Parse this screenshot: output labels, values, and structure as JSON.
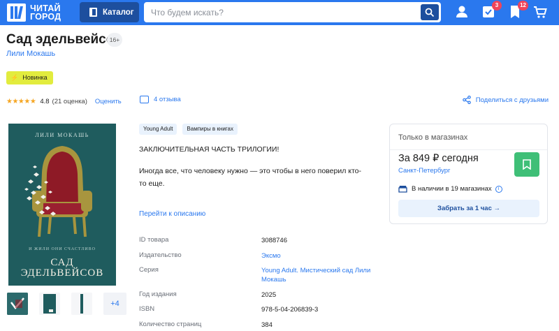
{
  "header": {
    "logo_line1": "ЧИТАЙ",
    "logo_line2": "ГОРОД",
    "catalog_label": "Каталог",
    "search_placeholder": "Что будем искать?",
    "cart_badge": "3",
    "bookmarks_badge": "12",
    "accent": "#2a78ee",
    "dark_accent": "#1d4f9e"
  },
  "product": {
    "title": "Сад эдельвейсов",
    "age_rating": "16+",
    "author": "Лили Мокашь",
    "new_badge": "Новинка",
    "rating_value": "4.8",
    "rating_count": "(21 оценка)",
    "rate_label": "Оценить",
    "reviews_label": "4 отзыва",
    "share_label": "Поделиться с друзьями",
    "stars_filled": 5
  },
  "cover": {
    "author": "ЛИЛИ МОКАШЬ",
    "subtitle": "И ЖИЛИ ОНИ СЧАСТЛИВО",
    "title_line1": "САД",
    "title_line2": "ЭДЕЛЬВЕЙСОВ",
    "more_thumbs": "+4"
  },
  "description": {
    "tags": [
      "Young Adult",
      "Вампиры в книгах"
    ],
    "line1": "ЗАКЛЮЧИТЕЛЬНАЯ ЧАСТЬ ТРИЛОГИИ!",
    "line2": "Иногда все, что человеку нужно — это чтобы в него поверил кто-то еще.",
    "to_description": "Перейти к описанию"
  },
  "specs": [
    {
      "key": "ID товара",
      "value": "3088746"
    },
    {
      "key": "Издательство",
      "value": "Эксмо"
    },
    {
      "key": "Серия",
      "value": "Young Adult. Мистический сад Лили Мокашь"
    },
    {
      "key": "Год издания",
      "value": "2025"
    },
    {
      "key": "ISBN",
      "value": "978-5-04-206839-3"
    },
    {
      "key": "Количество страниц",
      "value": "384"
    }
  ],
  "buybox": {
    "only_in_shops": "Только в магазинах",
    "price": "За 849 ₽ сегодня",
    "city": "Санкт-Петербург",
    "availability": "В наличии в 19 магазинах",
    "pickup_label": "Забрать за 1 час  →",
    "fav_color": "#3fbf77"
  }
}
